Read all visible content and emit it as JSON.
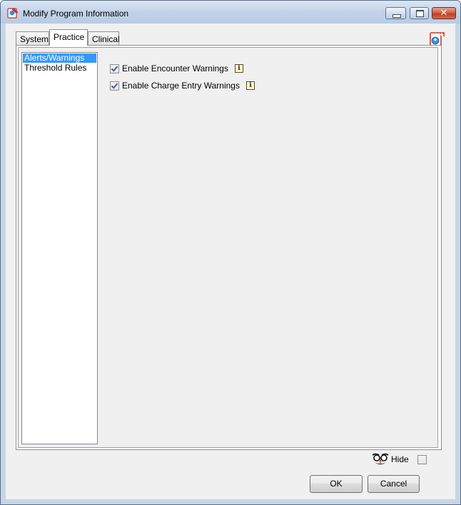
{
  "window": {
    "title": "Modify Program Information"
  },
  "tabs": [
    {
      "label": "System",
      "active": false
    },
    {
      "label": "Practice",
      "active": true
    },
    {
      "label": "Clinical",
      "active": false
    }
  ],
  "sidebar": {
    "items": [
      {
        "label": "Alerts/Warnings",
        "selected": true
      },
      {
        "label": "Threshold Rules",
        "selected": false
      }
    ]
  },
  "options": [
    {
      "label": "Enable Encounter Warnings",
      "checked": true
    },
    {
      "label": "Enable Charge Entry Warnings",
      "checked": true
    }
  ],
  "footer": {
    "hide_label": "Hide",
    "hide_checked": false,
    "ok_label": "OK",
    "cancel_label": "Cancel"
  },
  "colors": {
    "selection": "#3399ff",
    "title_bar": "#c2d3e8",
    "close_button": "#c0401f"
  }
}
